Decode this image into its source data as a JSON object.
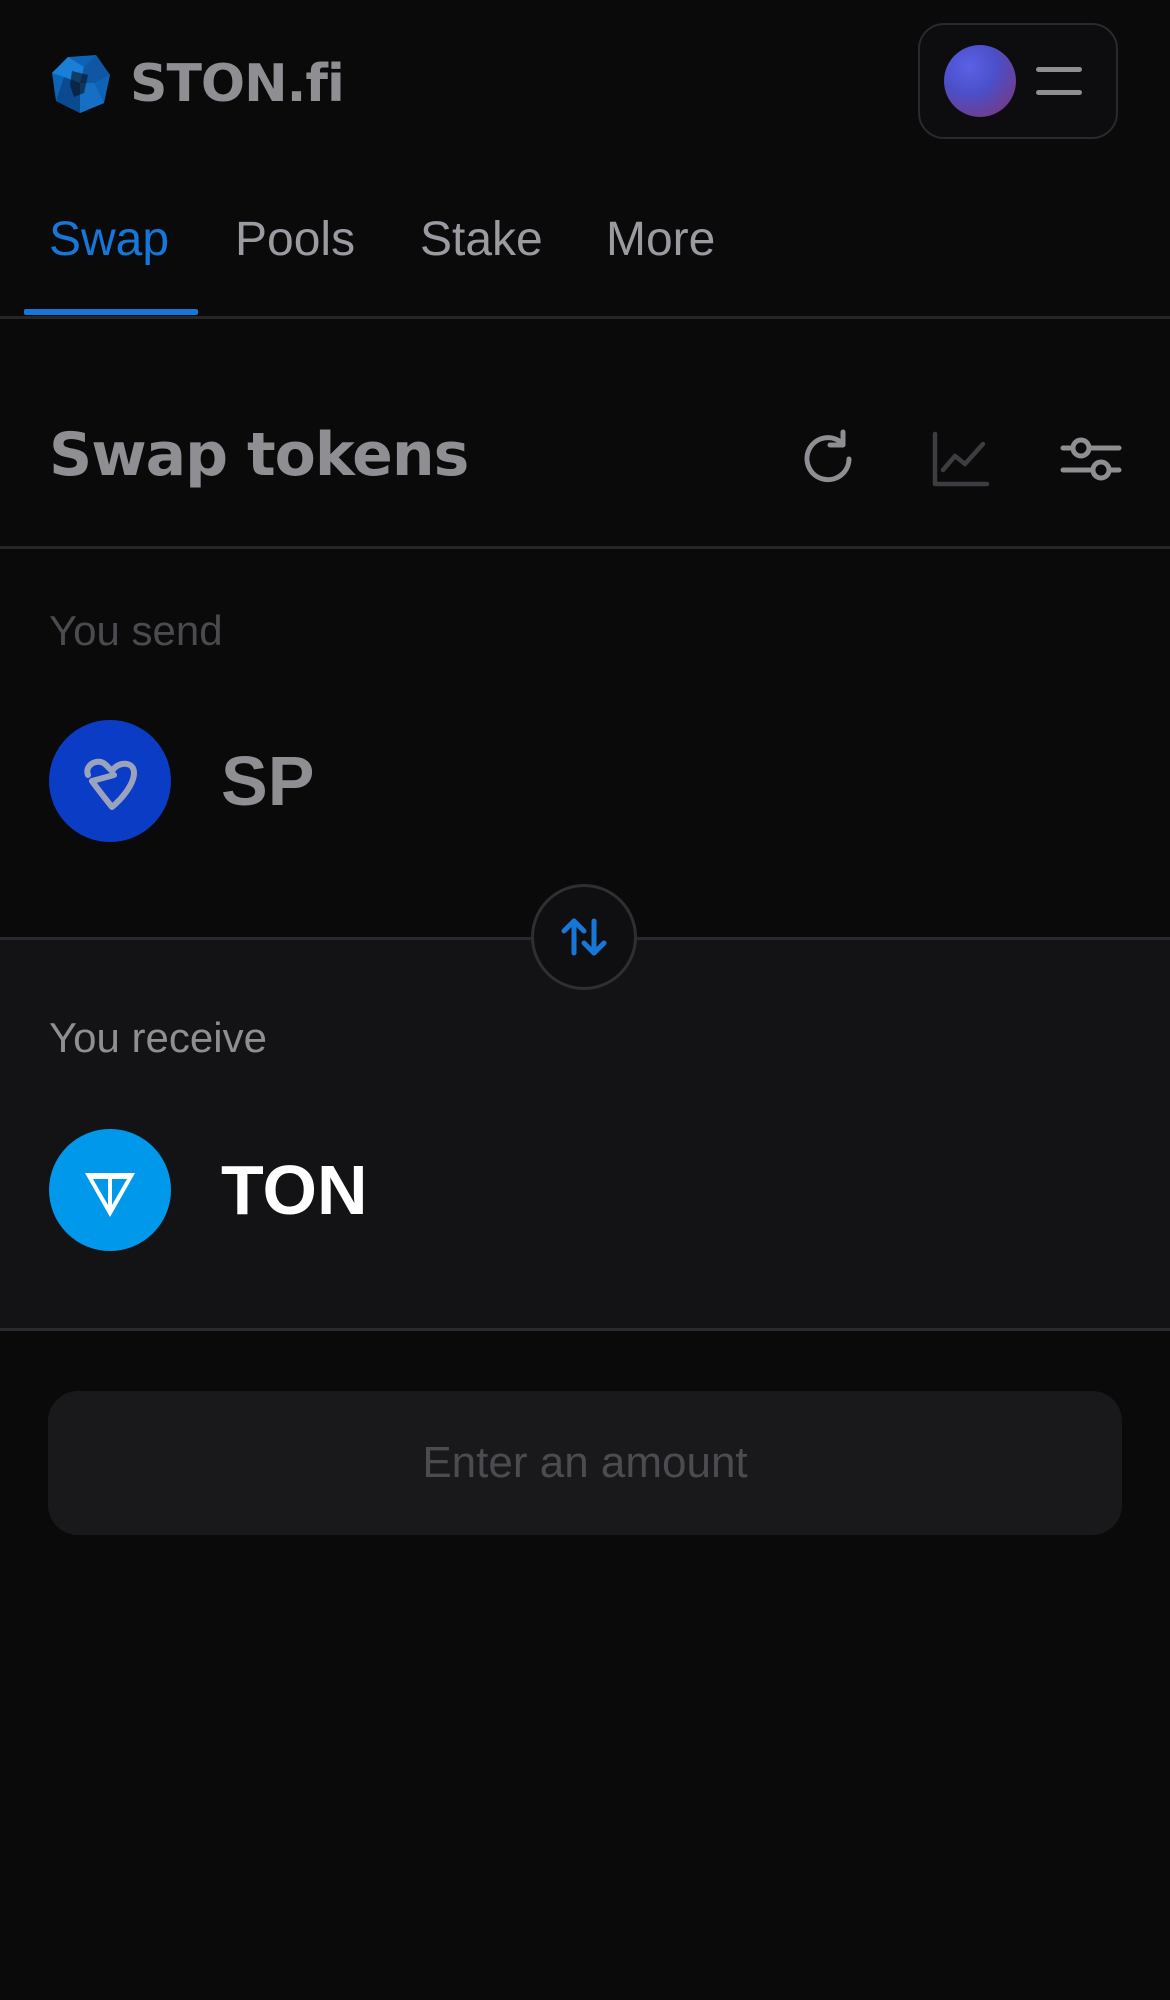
{
  "app": {
    "brand": "STON.fi"
  },
  "nav": {
    "tabs": [
      {
        "label": "Swap",
        "active": true
      },
      {
        "label": "Pools",
        "active": false
      },
      {
        "label": "Stake",
        "active": false
      },
      {
        "label": "More",
        "active": false
      }
    ]
  },
  "swap": {
    "title": "Swap tokens",
    "toolbar_icons": [
      "refresh-icon",
      "chart-icon",
      "settings-sliders-icon"
    ],
    "send": {
      "label": "You send",
      "token": "SP",
      "token_icon": "sp-token-icon"
    },
    "switch_icon": "swap-arrows-icon",
    "receive": {
      "label": "You receive",
      "token": "TON",
      "token_icon": "ton-token-icon"
    },
    "action_label": "Enter an amount"
  },
  "colors": {
    "accent": "#1677d8",
    "background": "#0a0a0b",
    "receive_panel": "#131316",
    "sp_token": "#0a3cc6",
    "ton_token": "#0098ea"
  }
}
